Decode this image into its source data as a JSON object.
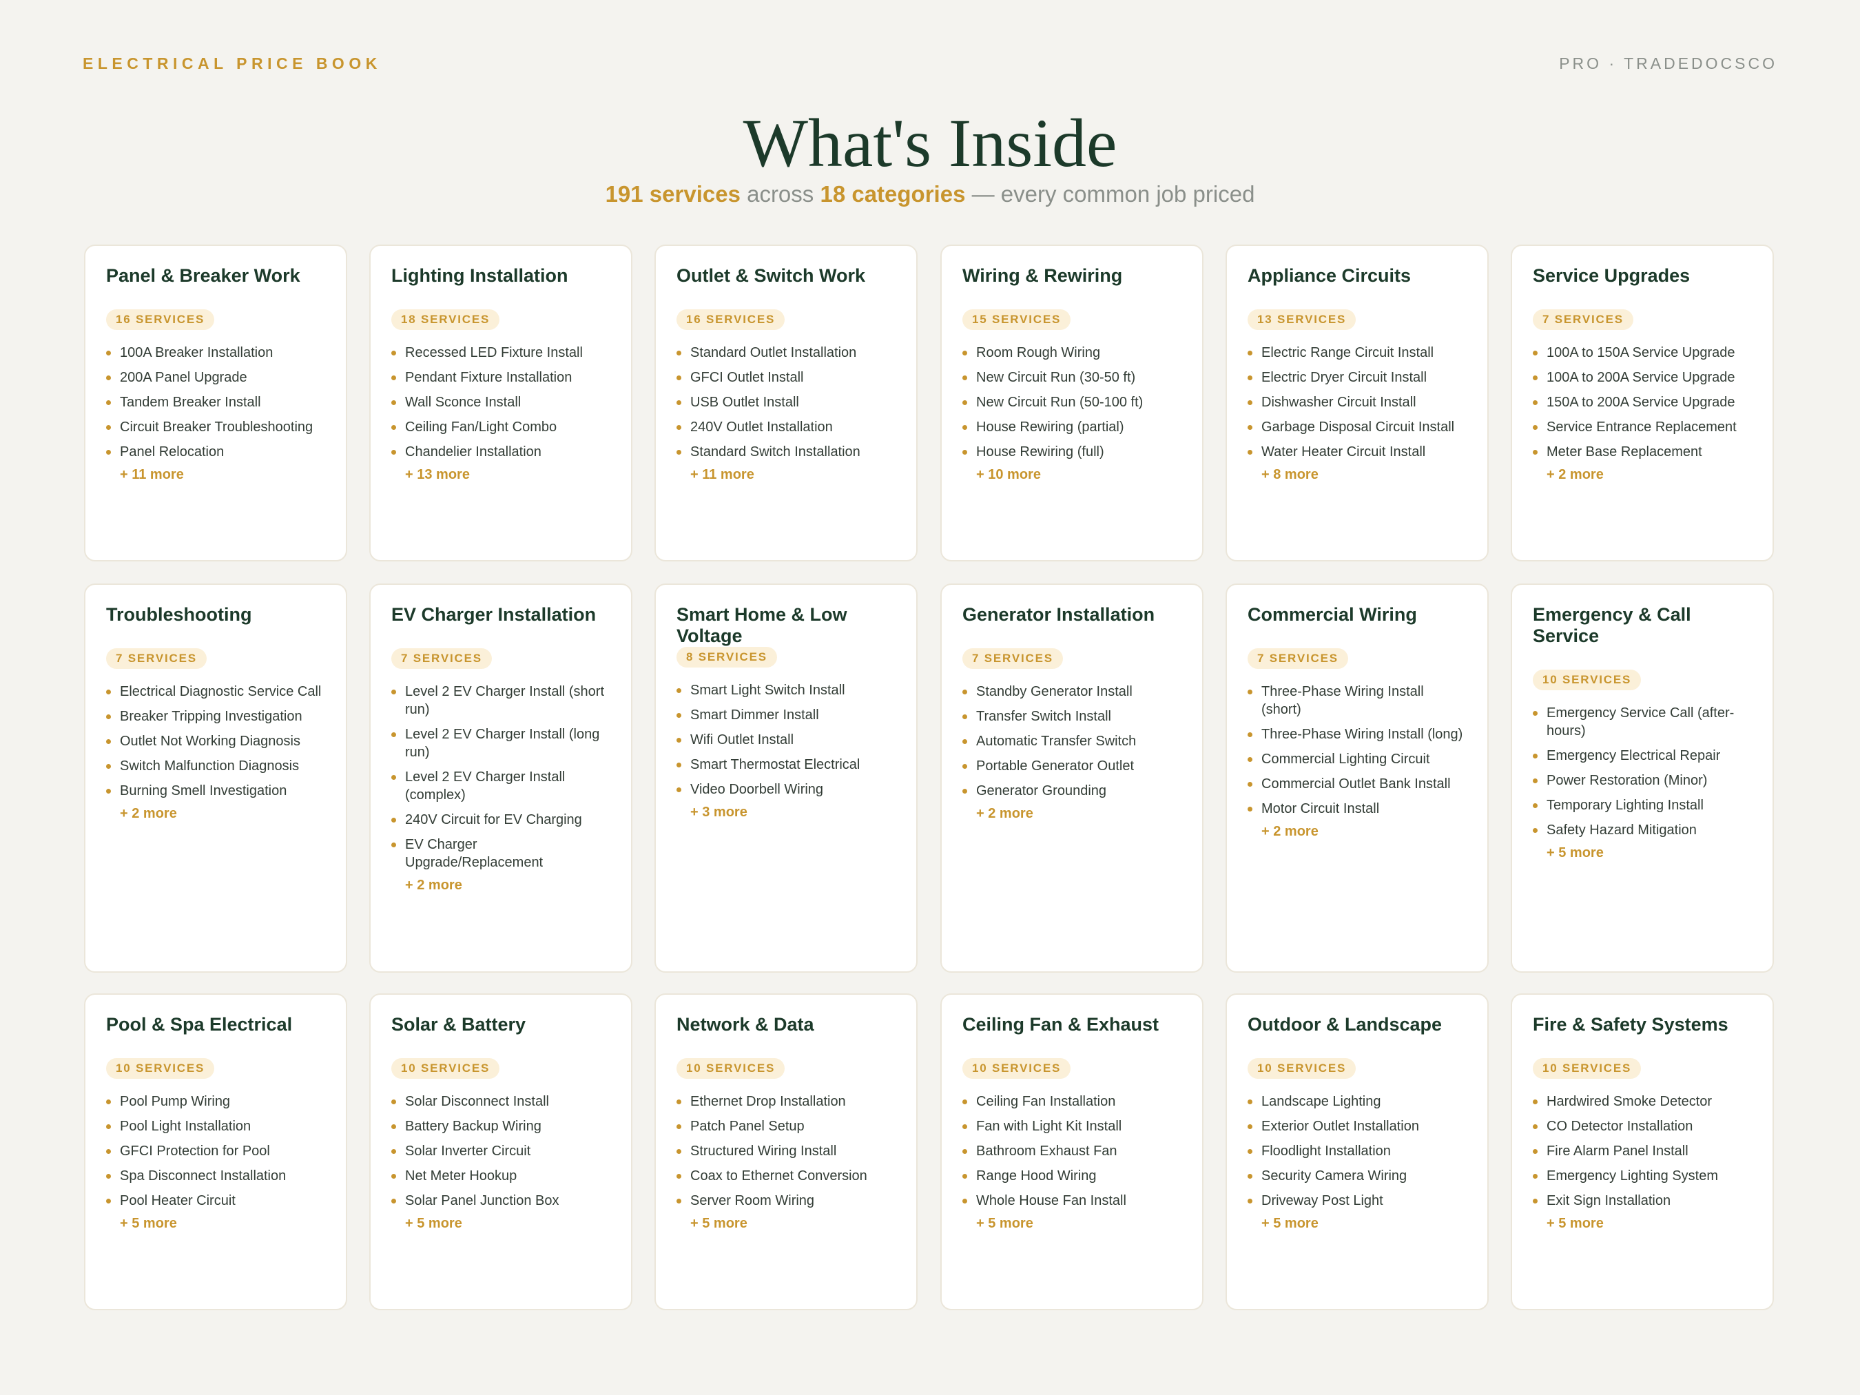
{
  "header": {
    "left_label": "ELECTRICAL PRICE BOOK",
    "right_label": "PRO · TRADEDOCSCO",
    "title": "What's Inside",
    "subtitle_services": "191 services",
    "subtitle_across": " across ",
    "subtitle_categories": "18 categories",
    "subtitle_rest": " — every common job priced"
  },
  "colors": {
    "accent": "#c8952e",
    "title": "#1c3a2a",
    "background": "#f4f3ef"
  },
  "categories": [
    {
      "title": "Panel & Breaker Work",
      "badge": "16 SERVICES",
      "items": [
        "100A Breaker Installation",
        "200A Panel Upgrade",
        "Tandem Breaker Install",
        "Circuit Breaker Troubleshooting",
        "Panel Relocation"
      ],
      "more": "+ 11 more"
    },
    {
      "title": "Lighting Installation",
      "badge": "18 SERVICES",
      "items": [
        "Recessed LED Fixture Install",
        "Pendant Fixture Installation",
        "Wall Sconce Install",
        "Ceiling Fan/Light Combo",
        "Chandelier Installation"
      ],
      "more": "+ 13 more"
    },
    {
      "title": "Outlet & Switch Work",
      "badge": "16 SERVICES",
      "items": [
        "Standard Outlet Installation",
        "GFCI Outlet Install",
        "USB Outlet Install",
        "240V Outlet Installation",
        "Standard Switch Installation"
      ],
      "more": "+ 11 more"
    },
    {
      "title": "Wiring & Rewiring",
      "badge": "15 SERVICES",
      "items": [
        "Room Rough Wiring",
        "New Circuit Run (30-50 ft)",
        "New Circuit Run (50-100 ft)",
        "House Rewiring (partial)",
        "House Rewiring (full)"
      ],
      "more": "+ 10 more"
    },
    {
      "title": "Appliance Circuits",
      "badge": "13 SERVICES",
      "items": [
        "Electric Range Circuit Install",
        "Electric Dryer Circuit Install",
        "Dishwasher Circuit Install",
        "Garbage Disposal Circuit Install",
        "Water Heater Circuit Install"
      ],
      "more": "+ 8 more"
    },
    {
      "title": "Service Upgrades",
      "badge": "7 SERVICES",
      "items": [
        "100A to 150A Service Upgrade",
        "100A to 200A Service Upgrade",
        "150A to 200A Service Upgrade",
        "Service Entrance Replacement",
        "Meter Base Replacement"
      ],
      "more": "+ 2 more"
    },
    {
      "title": "Troubleshooting",
      "badge": "7 SERVICES",
      "items": [
        "Electrical Diagnostic Service Call",
        "Breaker Tripping Investigation",
        "Outlet Not Working Diagnosis",
        "Switch Malfunction Diagnosis",
        "Burning Smell Investigation"
      ],
      "more": "+ 2 more"
    },
    {
      "title": "EV Charger Installation",
      "badge": "7 SERVICES",
      "items": [
        "Level 2 EV Charger Install (short run)",
        "Level 2 EV Charger Install (long run)",
        "Level 2 EV Charger Install (complex)",
        "240V Circuit for EV Charging",
        "EV Charger Upgrade/Replacement"
      ],
      "more": "+ 2 more"
    },
    {
      "title": "Smart Home & Low Voltage",
      "badge": "8 SERVICES",
      "items": [
        "Smart Light Switch Install",
        "Smart Dimmer Install",
        "Wifi Outlet Install",
        "Smart Thermostat Electrical",
        "Video Doorbell Wiring"
      ],
      "more": "+ 3 more"
    },
    {
      "title": "Generator Installation",
      "badge": "7 SERVICES",
      "items": [
        "Standby Generator Install",
        "Transfer Switch Install",
        "Automatic Transfer Switch",
        "Portable Generator Outlet",
        "Generator Grounding"
      ],
      "more": "+ 2 more"
    },
    {
      "title": "Commercial Wiring",
      "badge": "7 SERVICES",
      "items": [
        "Three-Phase Wiring Install (short)",
        "Three-Phase Wiring Install (long)",
        "Commercial Lighting Circuit",
        "Commercial Outlet Bank Install",
        "Motor Circuit Install"
      ],
      "more": "+ 2 more"
    },
    {
      "title": "Emergency & Call Service",
      "badge": "10 SERVICES",
      "items": [
        "Emergency Service Call (after-hours)",
        "Emergency Electrical Repair",
        "Power Restoration (Minor)",
        "Temporary Lighting Install",
        "Safety Hazard Mitigation"
      ],
      "more": "+ 5 more"
    },
    {
      "title": "Pool & Spa Electrical",
      "badge": "10 SERVICES",
      "items": [
        "Pool Pump Wiring",
        "Pool Light Installation",
        "GFCI Protection for Pool",
        "Spa Disconnect Installation",
        "Pool Heater Circuit"
      ],
      "more": "+ 5 more"
    },
    {
      "title": "Solar & Battery",
      "badge": "10 SERVICES",
      "items": [
        "Solar Disconnect Install",
        "Battery Backup Wiring",
        "Solar Inverter Circuit",
        "Net Meter Hookup",
        "Solar Panel Junction Box"
      ],
      "more": "+ 5 more"
    },
    {
      "title": "Network & Data",
      "badge": "10 SERVICES",
      "items": [
        "Ethernet Drop Installation",
        "Patch Panel Setup",
        "Structured Wiring Install",
        "Coax to Ethernet Conversion",
        "Server Room Wiring"
      ],
      "more": "+ 5 more"
    },
    {
      "title": "Ceiling Fan & Exhaust",
      "badge": "10 SERVICES",
      "items": [
        "Ceiling Fan Installation",
        "Fan with Light Kit Install",
        "Bathroom Exhaust Fan",
        "Range Hood Wiring",
        "Whole House Fan Install"
      ],
      "more": "+ 5 more"
    },
    {
      "title": "Outdoor & Landscape",
      "badge": "10 SERVICES",
      "items": [
        "Landscape Lighting",
        "Exterior Outlet Installation",
        "Floodlight Installation",
        "Security Camera Wiring",
        "Driveway Post Light"
      ],
      "more": "+ 5 more"
    },
    {
      "title": "Fire & Safety Systems",
      "badge": "10 SERVICES",
      "items": [
        "Hardwired Smoke Detector",
        "CO Detector Installation",
        "Fire Alarm Panel Install",
        "Emergency Lighting System",
        "Exit Sign Installation"
      ],
      "more": "+ 5 more"
    }
  ]
}
